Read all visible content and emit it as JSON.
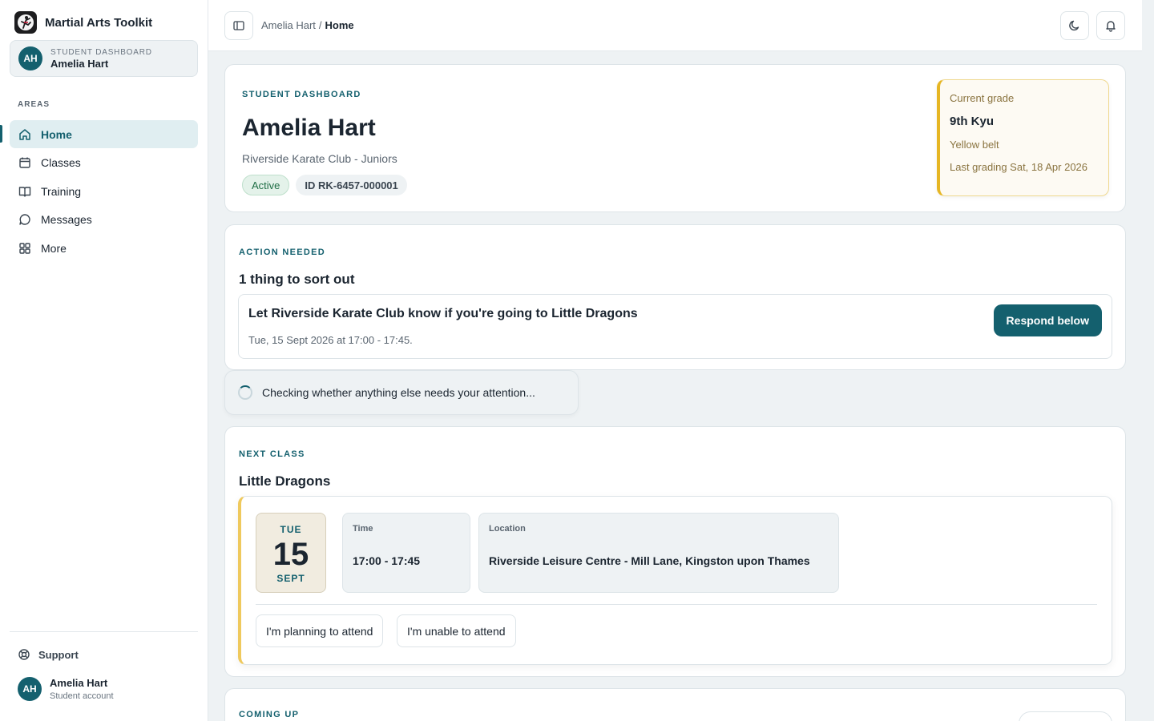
{
  "app": {
    "title": "Martial Arts Toolkit",
    "logo_icon": "martial-artist-logo"
  },
  "sidebar": {
    "user_card": {
      "initials": "AH",
      "role": "STUDENT DASHBOARD",
      "name": "Amelia Hart"
    },
    "areas_label": "AREAS",
    "items": [
      {
        "label": "Home",
        "icon": "home-icon",
        "active": true
      },
      {
        "label": "Classes",
        "icon": "calendar-icon",
        "active": false
      },
      {
        "label": "Training",
        "icon": "book-icon",
        "active": false
      },
      {
        "label": "Messages",
        "icon": "message-icon",
        "active": false
      },
      {
        "label": "More",
        "icon": "grid-icon",
        "active": false
      }
    ],
    "support_label": "Support",
    "account": {
      "initials": "AH",
      "name": "Amelia Hart",
      "sub": "Student account"
    }
  },
  "topbar": {
    "breadcrumb": [
      "Amelia Hart",
      "Home"
    ],
    "separator": "/"
  },
  "profile": {
    "eyebrow": "STUDENT DASHBOARD",
    "name": "Amelia Hart",
    "club": "Riverside Karate Club - Juniors",
    "status": "Active",
    "id": "ID RK-6457-000001",
    "grade": {
      "label": "Current grade",
      "value": "9th Kyu",
      "belt": "Yellow belt",
      "last_grading": "Last grading Sat, 18 Apr 2026"
    }
  },
  "action": {
    "eyebrow": "ACTION NEEDED",
    "heading": "1 thing to sort out",
    "task_title": "Let Riverside Karate Club know if you're going to Little Dragons",
    "task_sub": "Tue, 15 Sept 2026 at 17:00 - 17:45.",
    "button": "Respond below"
  },
  "checking_text": "Checking whether anything else needs your attention...",
  "next_class": {
    "eyebrow": "NEXT CLASS",
    "name": "Little Dragons",
    "dow": "TUE",
    "day": "15",
    "month": "SEPT",
    "time_label": "Time",
    "time": "17:00 - 17:45",
    "location_label": "Location",
    "location": "Riverside Leisure Centre - Mill Lane, Kingston upon Thames",
    "attend_button": "I'm planning to attend",
    "unable_button": "I'm unable to attend"
  },
  "coming_up": {
    "eyebrow": "COMING UP"
  },
  "colors": {
    "brand": "#14606e",
    "grade_accent": "#e6b624",
    "active_pill": "#1f6e45"
  }
}
